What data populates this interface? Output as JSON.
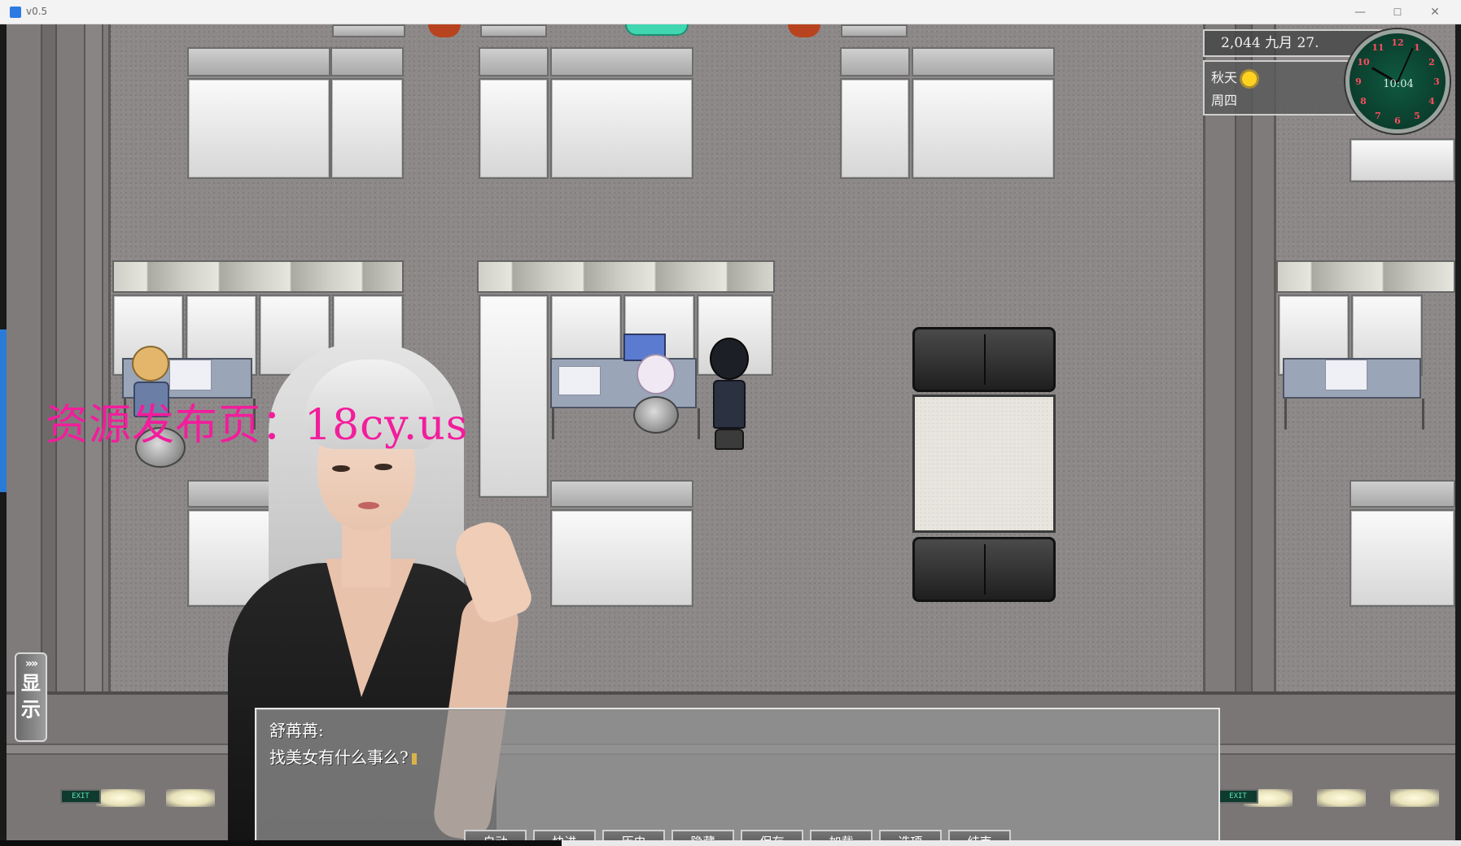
{
  "window": {
    "title": "v0.5",
    "controls": {
      "minimize": "—",
      "maximize": "☐",
      "close": "✕"
    }
  },
  "hud": {
    "date": "2,044 九月 27.",
    "season": "秋天",
    "weekday": "周四",
    "weather_icon": "sun-icon",
    "clock": {
      "digital": "10:04",
      "numerals": [
        "12",
        "1",
        "2",
        "3",
        "4",
        "5",
        "6",
        "7",
        "8",
        "9",
        "10",
        "11"
      ]
    }
  },
  "watermark": "资源发布页：18cy.us",
  "side_toggle": {
    "chevron": "»»",
    "label_line1": "显",
    "label_line2": "示"
  },
  "dialog": {
    "speaker": "舒苒苒:",
    "text": "找美女有什么事么?"
  },
  "menu": {
    "auto": "自动",
    "skip": "快进",
    "history": "历史",
    "hide": "隐藏",
    "save": "保存",
    "load": "加载",
    "options": "选项",
    "end": "结束"
  },
  "exit_signs": [
    "EXIT",
    "EXIT"
  ],
  "colors": {
    "watermark": "#f21d9c",
    "dialog_bg": "#969696",
    "clock_face": "#0b3d2d",
    "floor": "#8e8989"
  }
}
